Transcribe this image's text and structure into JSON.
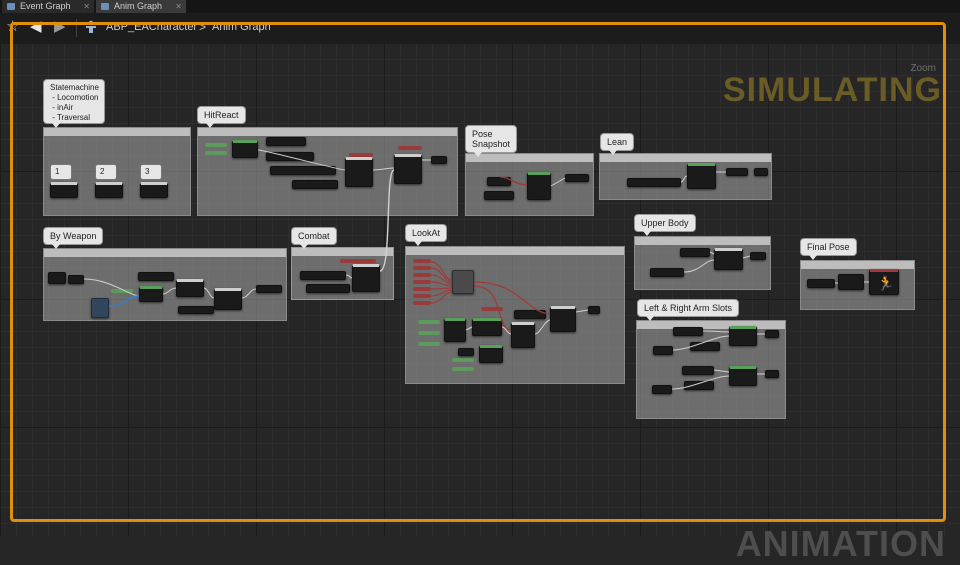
{
  "tabs": [
    {
      "label": "Event Graph",
      "active": false
    },
    {
      "label": "Anim Graph",
      "active": true
    }
  ],
  "breadcrumb": {
    "asset": "ABP_EACharacter",
    "separator": ">",
    "graph": "Anim Graph"
  },
  "overlay": {
    "zoom": "Zoom",
    "simulating": "SIMULATING",
    "watermark": "ANIMATION"
  },
  "comments": {
    "statemachine": "Statemachine\n - Locomotion\n - inAir\n - Traversal",
    "hitreact": "HitReact",
    "pose_snapshot": "Pose\nSnapshot",
    "lean": "Lean",
    "by_weapon": "By Weapon",
    "combat": "Combat",
    "lookat": "LookAt",
    "upper_body": "Upper Body",
    "final_pose": "Final Pose",
    "arm_slots": "Left & Right Arm Slots"
  },
  "state_buttons": [
    "1",
    "2",
    "3"
  ],
  "colors": {
    "simulating_border": "#e08e0b",
    "exec_pin": "#5aa05a",
    "pose_pin": "#a03a3a",
    "graph_bg": "#262626"
  }
}
